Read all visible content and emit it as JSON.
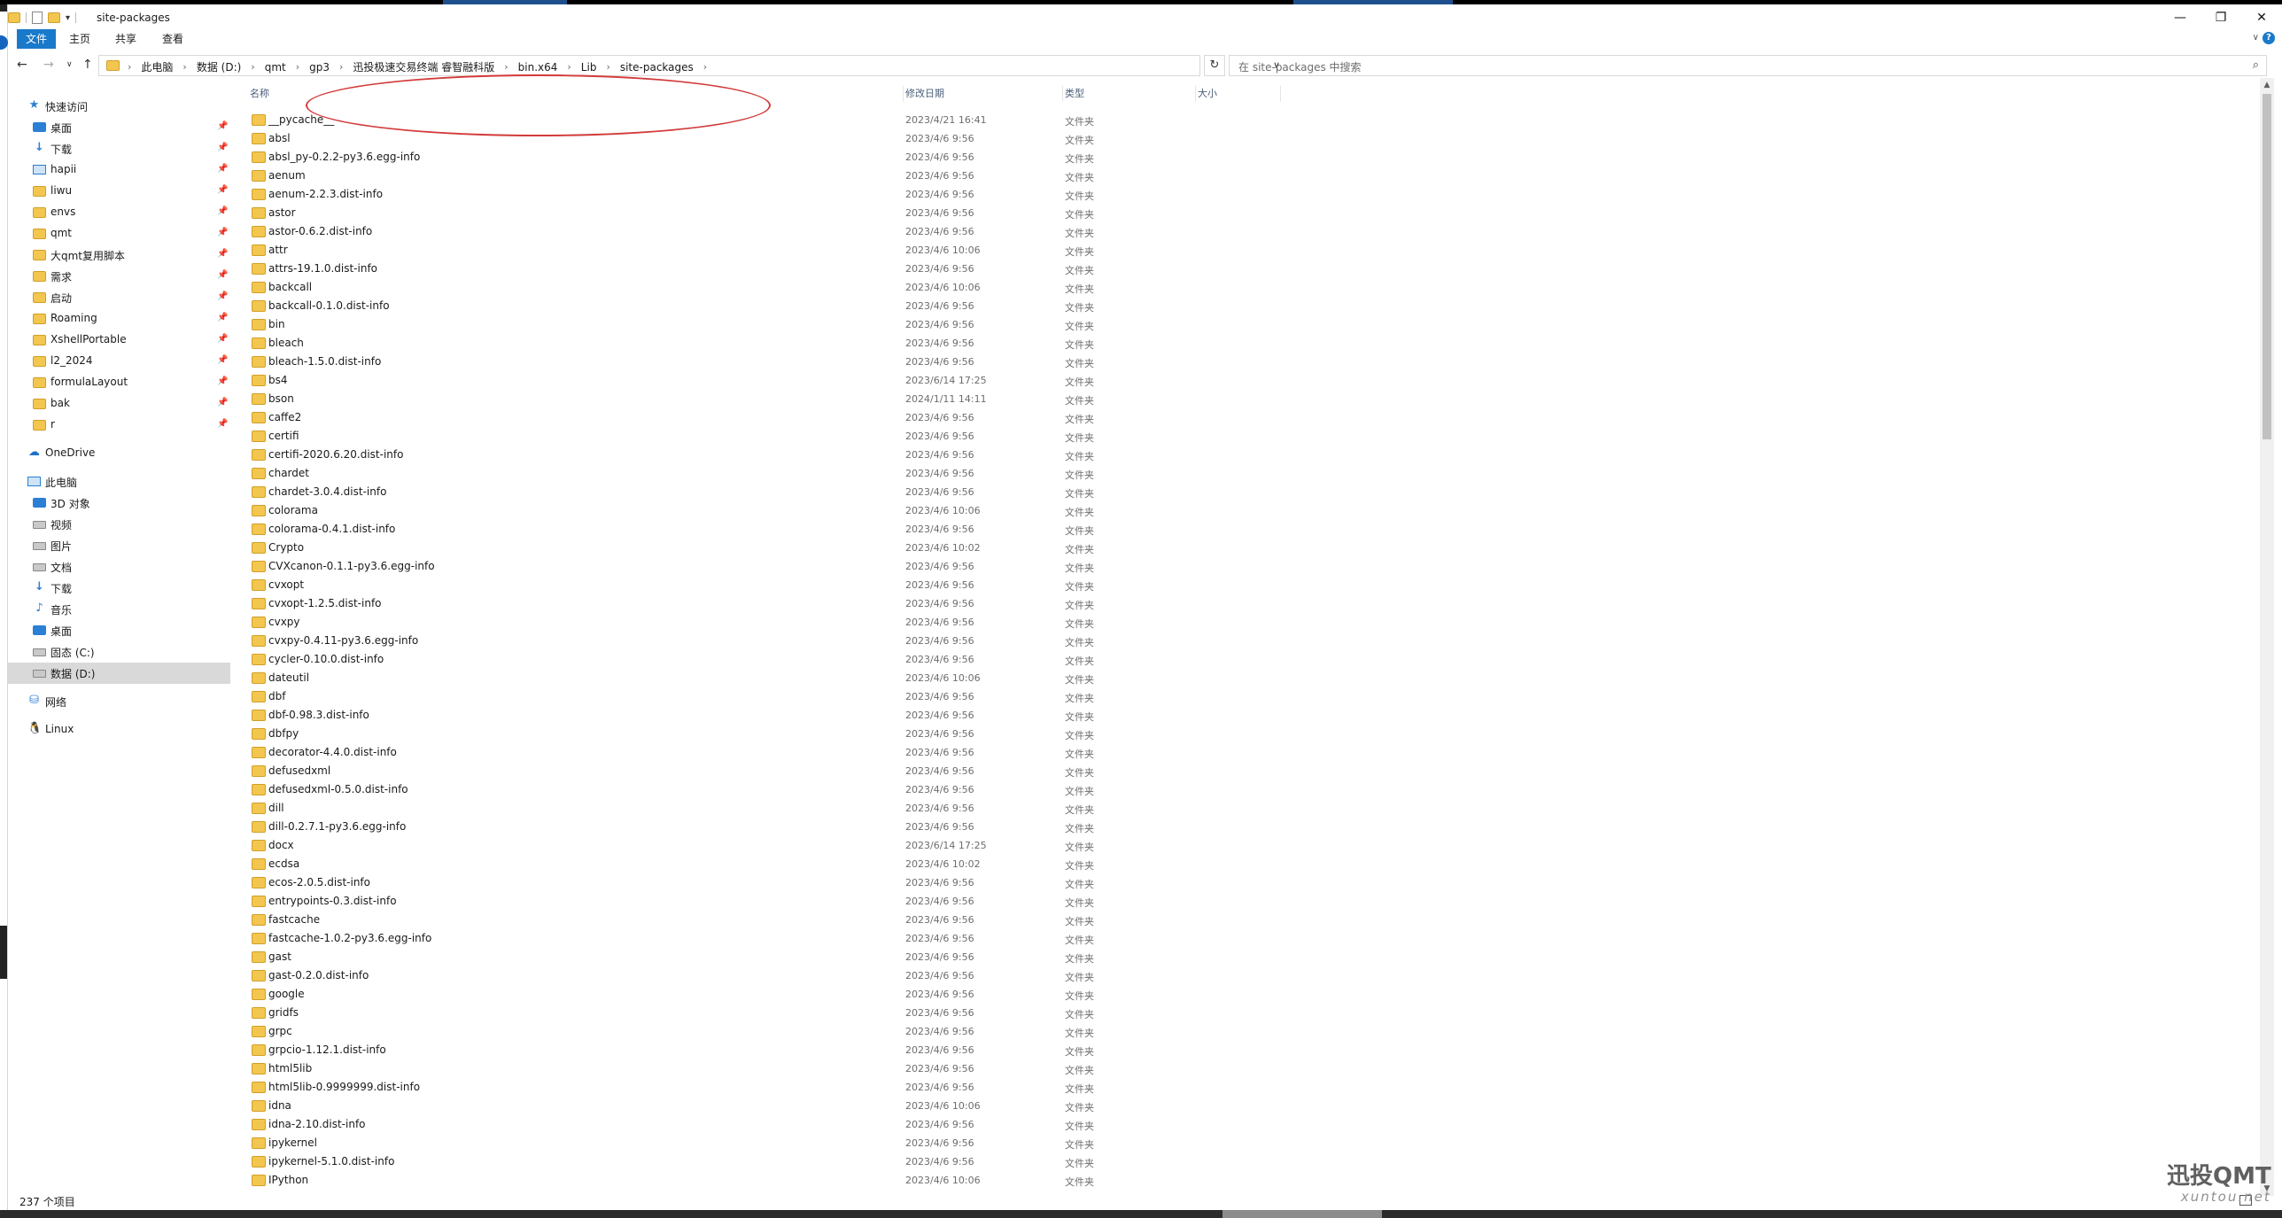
{
  "window": {
    "title": "site-packages",
    "controls": {
      "minimize": "—",
      "maximize": "❐",
      "close": "✕"
    }
  },
  "ribbon": {
    "file_tab": "文件",
    "tabs": [
      "主页",
      "共享",
      "查看"
    ],
    "expand": "∨",
    "help": "?"
  },
  "address": {
    "back": "←",
    "forward": "→",
    "recent": "∨",
    "up": "↑",
    "crumbs": [
      "此电脑",
      "数据 (D:)",
      "qmt",
      "gp3",
      "迅投极速交易终端 睿智融科版",
      "bin.x64",
      "Lib",
      "site-packages"
    ],
    "separator": "›",
    "dropdown": "∨",
    "refresh": "↻"
  },
  "search": {
    "placeholder": "在 site-packages 中搜索",
    "icon": "⌕"
  },
  "columns": {
    "name": "名称",
    "modified": "修改日期",
    "type": "类型",
    "size": "大小"
  },
  "nav": {
    "quick_access": {
      "label": "快速访问",
      "icon": "star-icon"
    },
    "pinned": [
      {
        "label": "桌面",
        "icon": "desktop-icon"
      },
      {
        "label": "下载",
        "icon": "download-icon"
      },
      {
        "label": "hapii",
        "icon": "monitor-icon"
      },
      {
        "label": "liwu",
        "icon": "folder-icon"
      },
      {
        "label": "envs",
        "icon": "folder-icon"
      },
      {
        "label": "qmt",
        "icon": "folder-icon"
      },
      {
        "label": "大qmt复用脚本",
        "icon": "folder-icon"
      },
      {
        "label": "需求",
        "icon": "folder-icon"
      },
      {
        "label": "启动",
        "icon": "folder-icon"
      },
      {
        "label": "Roaming",
        "icon": "folder-icon"
      },
      {
        "label": "XshellPortable",
        "icon": "folder-icon"
      },
      {
        "label": "l2_2024",
        "icon": "folder-icon"
      },
      {
        "label": "formulaLayout",
        "icon": "folder-icon"
      },
      {
        "label": "bak",
        "icon": "folder-icon"
      },
      {
        "label": "r",
        "icon": "folder-icon"
      }
    ],
    "onedrive": "OneDrive",
    "this_pc": "此电脑",
    "pc_items": [
      {
        "label": "3D 对象",
        "icon": "3d-objects-icon"
      },
      {
        "label": "视频",
        "icon": "video-icon"
      },
      {
        "label": "图片",
        "icon": "pictures-icon"
      },
      {
        "label": "文档",
        "icon": "documents-icon"
      },
      {
        "label": "下载",
        "icon": "download-icon"
      },
      {
        "label": "音乐",
        "icon": "music-icon"
      },
      {
        "label": "桌面",
        "icon": "desktop-icon"
      },
      {
        "label": "固态 (C:)",
        "icon": "drive-icon"
      },
      {
        "label": "数据 (D:)",
        "icon": "drive-icon",
        "selected": true
      }
    ],
    "network": "网络",
    "linux": "Linux"
  },
  "files": [
    {
      "name": "__pycache__",
      "date": "2023/4/21 16:41",
      "type": "文件夹"
    },
    {
      "name": "absl",
      "date": "2023/4/6 9:56",
      "type": "文件夹"
    },
    {
      "name": "absl_py-0.2.2-py3.6.egg-info",
      "date": "2023/4/6 9:56",
      "type": "文件夹"
    },
    {
      "name": "aenum",
      "date": "2023/4/6 9:56",
      "type": "文件夹"
    },
    {
      "name": "aenum-2.2.3.dist-info",
      "date": "2023/4/6 9:56",
      "type": "文件夹"
    },
    {
      "name": "astor",
      "date": "2023/4/6 9:56",
      "type": "文件夹"
    },
    {
      "name": "astor-0.6.2.dist-info",
      "date": "2023/4/6 9:56",
      "type": "文件夹"
    },
    {
      "name": "attr",
      "date": "2023/4/6 10:06",
      "type": "文件夹"
    },
    {
      "name": "attrs-19.1.0.dist-info",
      "date": "2023/4/6 9:56",
      "type": "文件夹"
    },
    {
      "name": "backcall",
      "date": "2023/4/6 10:06",
      "type": "文件夹"
    },
    {
      "name": "backcall-0.1.0.dist-info",
      "date": "2023/4/6 9:56",
      "type": "文件夹"
    },
    {
      "name": "bin",
      "date": "2023/4/6 9:56",
      "type": "文件夹"
    },
    {
      "name": "bleach",
      "date": "2023/4/6 9:56",
      "type": "文件夹"
    },
    {
      "name": "bleach-1.5.0.dist-info",
      "date": "2023/4/6 9:56",
      "type": "文件夹"
    },
    {
      "name": "bs4",
      "date": "2023/6/14 17:25",
      "type": "文件夹"
    },
    {
      "name": "bson",
      "date": "2024/1/11 14:11",
      "type": "文件夹"
    },
    {
      "name": "caffe2",
      "date": "2023/4/6 9:56",
      "type": "文件夹"
    },
    {
      "name": "certifi",
      "date": "2023/4/6 9:56",
      "type": "文件夹"
    },
    {
      "name": "certifi-2020.6.20.dist-info",
      "date": "2023/4/6 9:56",
      "type": "文件夹"
    },
    {
      "name": "chardet",
      "date": "2023/4/6 9:56",
      "type": "文件夹"
    },
    {
      "name": "chardet-3.0.4.dist-info",
      "date": "2023/4/6 9:56",
      "type": "文件夹"
    },
    {
      "name": "colorama",
      "date": "2023/4/6 10:06",
      "type": "文件夹"
    },
    {
      "name": "colorama-0.4.1.dist-info",
      "date": "2023/4/6 9:56",
      "type": "文件夹"
    },
    {
      "name": "Crypto",
      "date": "2023/4/6 10:02",
      "type": "文件夹"
    },
    {
      "name": "CVXcanon-0.1.1-py3.6.egg-info",
      "date": "2023/4/6 9:56",
      "type": "文件夹"
    },
    {
      "name": "cvxopt",
      "date": "2023/4/6 9:56",
      "type": "文件夹"
    },
    {
      "name": "cvxopt-1.2.5.dist-info",
      "date": "2023/4/6 9:56",
      "type": "文件夹"
    },
    {
      "name": "cvxpy",
      "date": "2023/4/6 9:56",
      "type": "文件夹"
    },
    {
      "name": "cvxpy-0.4.11-py3.6.egg-info",
      "date": "2023/4/6 9:56",
      "type": "文件夹"
    },
    {
      "name": "cycler-0.10.0.dist-info",
      "date": "2023/4/6 9:56",
      "type": "文件夹"
    },
    {
      "name": "dateutil",
      "date": "2023/4/6 10:06",
      "type": "文件夹"
    },
    {
      "name": "dbf",
      "date": "2023/4/6 9:56",
      "type": "文件夹"
    },
    {
      "name": "dbf-0.98.3.dist-info",
      "date": "2023/4/6 9:56",
      "type": "文件夹"
    },
    {
      "name": "dbfpy",
      "date": "2023/4/6 9:56",
      "type": "文件夹"
    },
    {
      "name": "decorator-4.4.0.dist-info",
      "date": "2023/4/6 9:56",
      "type": "文件夹"
    },
    {
      "name": "defusedxml",
      "date": "2023/4/6 9:56",
      "type": "文件夹"
    },
    {
      "name": "defusedxml-0.5.0.dist-info",
      "date": "2023/4/6 9:56",
      "type": "文件夹"
    },
    {
      "name": "dill",
      "date": "2023/4/6 9:56",
      "type": "文件夹"
    },
    {
      "name": "dill-0.2.7.1-py3.6.egg-info",
      "date": "2023/4/6 9:56",
      "type": "文件夹"
    },
    {
      "name": "docx",
      "date": "2023/6/14 17:25",
      "type": "文件夹"
    },
    {
      "name": "ecdsa",
      "date": "2023/4/6 10:02",
      "type": "文件夹"
    },
    {
      "name": "ecos-2.0.5.dist-info",
      "date": "2023/4/6 9:56",
      "type": "文件夹"
    },
    {
      "name": "entrypoints-0.3.dist-info",
      "date": "2023/4/6 9:56",
      "type": "文件夹"
    },
    {
      "name": "fastcache",
      "date": "2023/4/6 9:56",
      "type": "文件夹"
    },
    {
      "name": "fastcache-1.0.2-py3.6.egg-info",
      "date": "2023/4/6 9:56",
      "type": "文件夹"
    },
    {
      "name": "gast",
      "date": "2023/4/6 9:56",
      "type": "文件夹"
    },
    {
      "name": "gast-0.2.0.dist-info",
      "date": "2023/4/6 9:56",
      "type": "文件夹"
    },
    {
      "name": "google",
      "date": "2023/4/6 9:56",
      "type": "文件夹"
    },
    {
      "name": "gridfs",
      "date": "2023/4/6 9:56",
      "type": "文件夹"
    },
    {
      "name": "grpc",
      "date": "2023/4/6 9:56",
      "type": "文件夹"
    },
    {
      "name": "grpcio-1.12.1.dist-info",
      "date": "2023/4/6 9:56",
      "type": "文件夹"
    },
    {
      "name": "html5lib",
      "date": "2023/4/6 9:56",
      "type": "文件夹"
    },
    {
      "name": "html5lib-0.9999999.dist-info",
      "date": "2023/4/6 9:56",
      "type": "文件夹"
    },
    {
      "name": "idna",
      "date": "2023/4/6 10:06",
      "type": "文件夹"
    },
    {
      "name": "idna-2.10.dist-info",
      "date": "2023/4/6 9:56",
      "type": "文件夹"
    },
    {
      "name": "ipykernel",
      "date": "2023/4/6 9:56",
      "type": "文件夹"
    },
    {
      "name": "ipykernel-5.1.0.dist-info",
      "date": "2023/4/6 9:56",
      "type": "文件夹"
    },
    {
      "name": "IPython",
      "date": "2023/4/6 10:06",
      "type": "文件夹"
    }
  ],
  "status": {
    "count": "237 个项目"
  },
  "watermark": {
    "line1": "迅投QMT",
    "line2": "xuntou.net"
  }
}
